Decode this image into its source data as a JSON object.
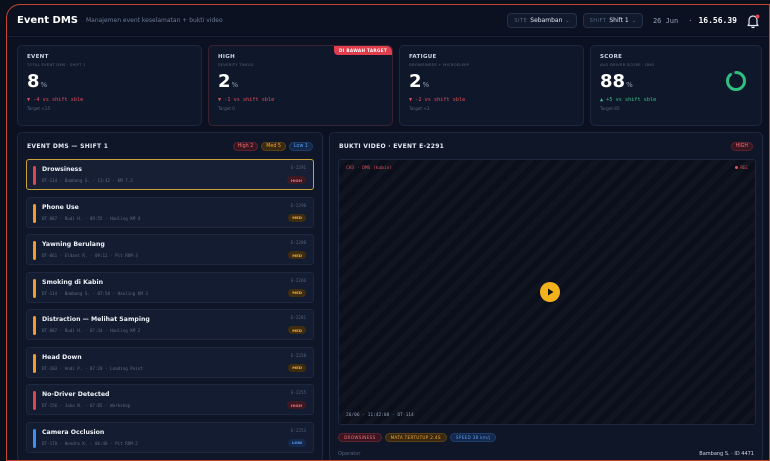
{
  "header": {
    "title": "Event DMS",
    "subtitle": "Manajemen event keselamatan + bukti video",
    "site_label": "SITE",
    "site_value": "Sebamban",
    "shift_label": "SHIFT",
    "shift_value": "Shift 1",
    "date": "26 Jun",
    "time_sep": "·",
    "time": "16.56.39"
  },
  "kpis": {
    "event": {
      "title": "EVENT",
      "sub": "TOTAL EVENT DMS · SHIFT 1",
      "value": "8",
      "unit": "%",
      "delta": "▼ -4 vs shift sble",
      "target": "Target <15"
    },
    "high": {
      "title": "HIGH",
      "sub": "SEVERITY TINGGI",
      "value": "2",
      "unit": "%",
      "delta": "▼ -1 vs shift sble",
      "target": "Target 0",
      "badge": "DI BAWAH TARGET"
    },
    "fatigue": {
      "title": "FATIGUE",
      "sub": "DROWSINESS + MICROSLEEP",
      "value": "2",
      "unit": "%",
      "delta": "▼ -2 vs shift sble",
      "target": "Target <3"
    },
    "score": {
      "title": "SCORE",
      "sub": "AVG DRIVER SCORE · DMS",
      "value": "88",
      "unit": "%",
      "delta": "▲ +5 vs shift sble",
      "target": "Target 85",
      "ring_fraction": 0.88
    }
  },
  "events_panel": {
    "title": "EVENT DMS — SHIFT 1",
    "chips": {
      "high": "High 2",
      "med": "Med 5",
      "low": "Low 1"
    },
    "items": [
      {
        "name": "Drowsiness",
        "meta": "DT-114 · Bambang S. · 11:42 · KM 7.2",
        "code": "E-2291",
        "sev": "HIGH",
        "sev_class": "high",
        "color": "#e0444f"
      },
      {
        "name": "Phone Use",
        "meta": "DT-087 · Rudi H. · 09:55 · Hauling KM 4",
        "code": "E-2290",
        "sev": "MED",
        "sev_class": "med",
        "color": "#f29a2e"
      },
      {
        "name": "Yawning Berulang",
        "meta": "DT-061 · Eldant R. · 09:12 · Pit ROM-3",
        "code": "E-2288",
        "sev": "MED",
        "sev_class": "med",
        "color": "#f29a2e"
      },
      {
        "name": "Smoking di Kabin",
        "meta": "DT-114 · Bambang S. · 07:58 · Hauling KM 3",
        "code": "E-2266",
        "sev": "MED",
        "sev_class": "med",
        "color": "#f29a2e"
      },
      {
        "name": "Distraction — Melihat Samping",
        "meta": "DT-087 · Rudi H. · 07:34 · Hauling KM 2",
        "code": "E-2281",
        "sev": "MED",
        "sev_class": "med",
        "color": "#f29a2e"
      },
      {
        "name": "Head Down",
        "meta": "DT-103 · Andi P. · 07:20 · Loading Point",
        "code": "E-2258",
        "sev": "MED",
        "sev_class": "med",
        "color": "#f29a2e"
      },
      {
        "name": "No-Driver Detected",
        "meta": "DT-156 · Joko N. · 07:05 · Workshop",
        "code": "E-2255",
        "sev": "HIGH",
        "sev_class": "high",
        "color": "#e0444f"
      },
      {
        "name": "Camera Occlusion",
        "meta": "DT-178 · Hendra K. · 06:48 · Pit ROM-2",
        "code": "E-2253",
        "sev": "LOW",
        "sev_class": "low",
        "color": "#3d8ff0"
      }
    ]
  },
  "video_panel": {
    "title": "BUKTI VIDEO · EVENT E-2291",
    "sev_chip": "HIGH",
    "cam_label": "CH3 · DMS (kabin)",
    "rec": "REC",
    "timestamp": "26/06 · 11:42:08 · DT-114",
    "tags": {
      "t1": "DROWSINESS",
      "t2": "MATA TERTUTUP 2.4S",
      "t3": "SPEED 38 km/j"
    },
    "operator_label": "Operator",
    "operator_value": "Bambang S. · ID 4471"
  },
  "colors": {
    "accent": "#f2b21c",
    "high": "#e0444f",
    "med": "#f29a2e",
    "low": "#3d8ff0",
    "ok": "#3ac28a"
  }
}
